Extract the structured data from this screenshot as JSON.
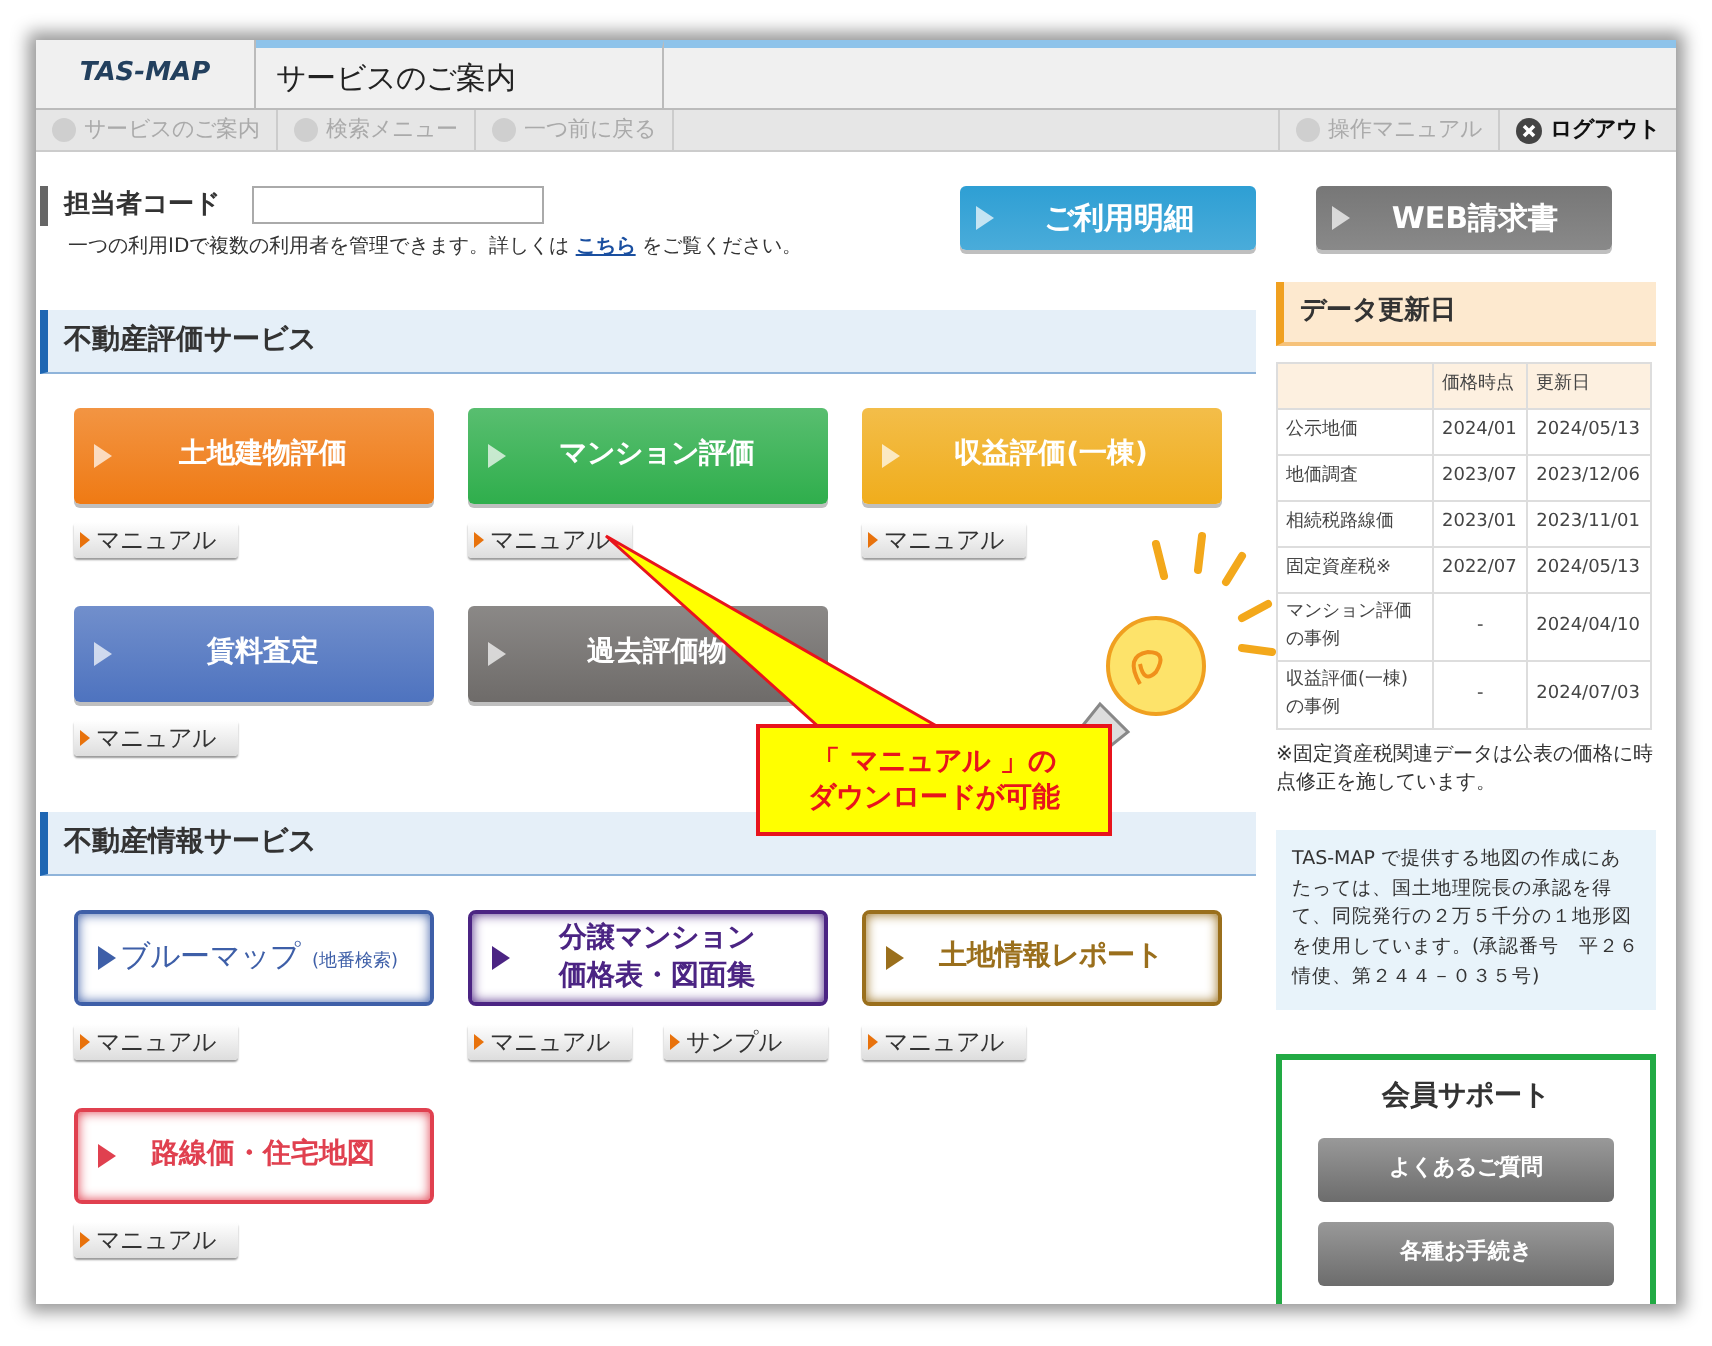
{
  "header": {
    "logo": "TAS-MAP",
    "title": "サービスのご案内"
  },
  "nav_left": [
    {
      "label": "サービスのご案内",
      "disabled": true
    },
    {
      "label": "検索メニュー",
      "disabled": true
    },
    {
      "label": "一つ前に戻る",
      "disabled": true
    }
  ],
  "nav_right": [
    {
      "label": "操作マニュアル",
      "disabled": true,
      "kind": "doc"
    },
    {
      "label": "ログアウト",
      "disabled": false,
      "kind": "logout"
    }
  ],
  "user_code": {
    "label": "担当者コード",
    "help": "一つの利用IDで複数の利用者を管理できます。詳しくは",
    "link": "こちら",
    "help_end": "をご覧ください。"
  },
  "usage_button": {
    "label": "ご利用明細",
    "color": "#2e9fd4"
  },
  "billing_button": {
    "label": "WEB請求書",
    "color": "#777777"
  },
  "sections": [
    {
      "title": "不動産評価サービス",
      "services": [
        {
          "label": "土地建物評価",
          "kind": "solid",
          "color": "#ef7a14",
          "links": [
            "マニュアル"
          ]
        },
        {
          "label": "マンション評価",
          "kind": "solid",
          "color": "#2fae4c",
          "links": [
            "マニュアル"
          ]
        },
        {
          "label": "収益評価(一棟)",
          "kind": "solid",
          "color": "#f0ad1c",
          "links": [
            "マニュアル"
          ]
        },
        {
          "label": "賃料査定",
          "kind": "solid",
          "color": "#4e73bf",
          "links": [
            "マニュアル"
          ]
        },
        {
          "label": "過去評価物",
          "kind": "solid",
          "color": "#6e6b69"
        }
      ]
    },
    {
      "title": "不動産情報サービス",
      "services": [
        {
          "label": "ブルーマップ",
          "note": "(地番検索)",
          "kind": "outline",
          "color": "#3e5fa8",
          "links": [
            "マニュアル"
          ]
        },
        {
          "lines": [
            "分譲マンション",
            "価格表・図面集"
          ],
          "kind": "outline",
          "color": "#4b2483",
          "links": [
            "マニュアル",
            "サンプル"
          ]
        },
        {
          "label": "土地情報レポート",
          "kind": "outline",
          "color": "#9a6f1c",
          "links": [
            "マニュアル"
          ]
        },
        {
          "label": "路線価・住宅地図",
          "kind": "outline",
          "color": "#e0404f",
          "links": [
            "マニュアル"
          ]
        }
      ]
    }
  ],
  "update": {
    "title": "データ更新日",
    "columns": [
      "",
      "価格時点",
      "更新日"
    ],
    "rows": [
      [
        "公示地価",
        "2024/01",
        "2024/05/13"
      ],
      [
        "地価調査",
        "2023/07",
        "2023/12/06"
      ],
      [
        "相続税路線価",
        "2023/01",
        "2023/11/01"
      ],
      [
        "固定資産税※",
        "2022/07",
        "2024/05/13"
      ],
      [
        "マンション評価の事例",
        "-",
        "2024/04/10"
      ],
      [
        "収益評価(一棟)の事例",
        "-",
        "2024/07/03"
      ]
    ],
    "note": "※固定資産税関連データは公表の価格に時点修正を施しています。"
  },
  "notice": "TAS-MAP で提供する地図の作成にあたっては、国土地理院長の承認を得て、同院発行の２万５千分の１地形図を使用しています。(承認番号　平２６情使、第２４４－０３５号)",
  "support": {
    "title": "会員サポート",
    "buttons": [
      "よくあるご質問",
      "各種お手続き"
    ]
  },
  "callout": {
    "lines": [
      "「 マニュアル 」の",
      "ダウンロードが可能"
    ]
  }
}
